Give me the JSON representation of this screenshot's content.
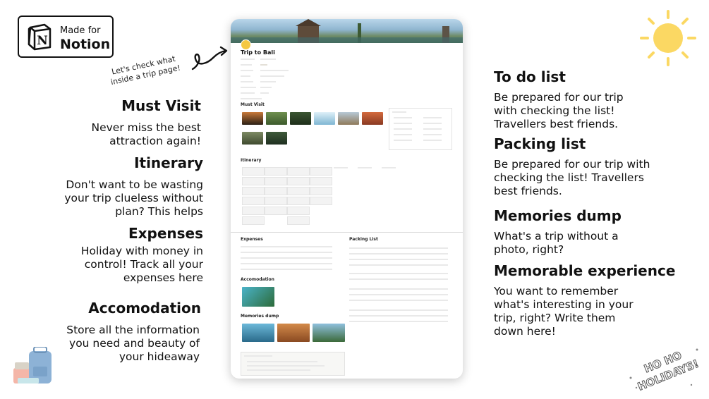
{
  "badge": {
    "made_for": "Made for",
    "brand": "Notion",
    "logo_letter": "N"
  },
  "hint": "Let's check what inside a trip page!",
  "left_sections": [
    {
      "heading": "Must Visit",
      "lines": [
        "Never miss the best",
        "attraction again!"
      ]
    },
    {
      "heading": "Itinerary",
      "lines": [
        "Don't want to be wasting",
        "your trip clueless without",
        "plan? This  helps"
      ]
    },
    {
      "heading": "Expenses",
      "lines": [
        "Holiday with money in",
        "control! Track all your",
        "expenses here"
      ]
    },
    {
      "heading": "Accomodation",
      "lines": [
        "Store all the information",
        "you need and beauty of",
        "your hideaway"
      ]
    }
  ],
  "right_sections": [
    {
      "heading": "To do list",
      "lines": [
        "Be prepared for our trip",
        "with checking the list!",
        "Travellers best friends."
      ]
    },
    {
      "heading": "Packing list",
      "lines": [
        "Be prepared for our trip with",
        "checking the list! Travellers",
        "best friends."
      ]
    },
    {
      "heading": "Memories dump",
      "lines": [
        "What's  a  trip  without  a",
        "photo, right?"
      ]
    },
    {
      "heading": "Memorable experience",
      "lines": [
        "You  want  to  remember",
        "what's  interesting  in  your",
        "trip,  right?   Write   them",
        "down here!"
      ]
    }
  ],
  "page": {
    "title": "Trip to Bali",
    "sections": {
      "must_visit": "Must Visit",
      "itinerary": "Itinerary",
      "expenses": "Expenses",
      "packing": "Packing List",
      "accomodation": "Accomodation",
      "memories": "Memories dump"
    }
  },
  "sticker": {
    "text": "HO HO HOLIDAYS!"
  },
  "colors": {
    "sun": "#fbd863",
    "luggage_blue": "#8db2d6",
    "luggage_pink": "#f2a7a2",
    "text": "#111111"
  }
}
